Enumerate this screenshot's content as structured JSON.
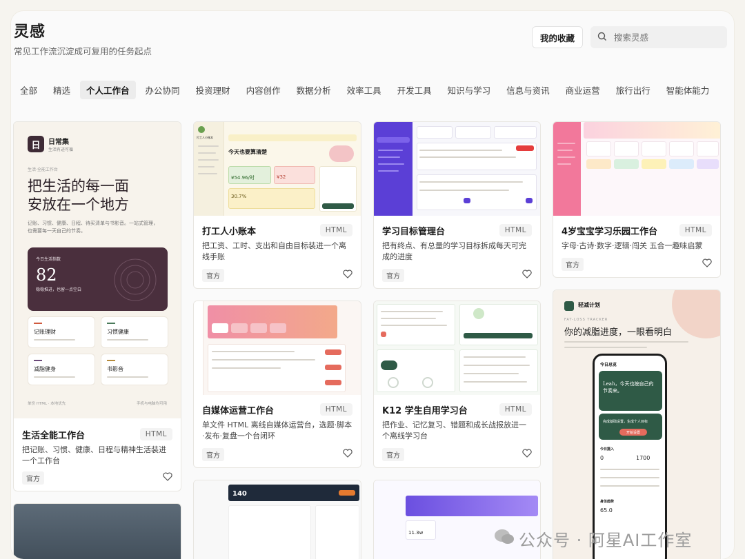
{
  "header": {
    "title": "灵感",
    "subtitle": "常见工作流沉淀成可复用的任务起点",
    "favorites_label": "我的收藏",
    "search_placeholder": "搜索灵感"
  },
  "tabs": [
    "全部",
    "精选",
    "个人工作台",
    "办公协同",
    "投资理财",
    "内容创作",
    "数据分析",
    "效率工具",
    "开发工具",
    "知识与学习",
    "信息与资讯",
    "商业运营",
    "旅行出行",
    "智能体能力"
  ],
  "active_tab": "个人工作台",
  "cards": [
    {
      "title": "生活全能工作台",
      "badge": "HTML",
      "desc": "把记账、习惯、健康、日程与精神生活装进一个工作台",
      "tag": "官方"
    },
    {
      "title": "打工人小账本",
      "badge": "HTML",
      "desc": "把工资、工时、支出和自由目标装进一个离线手账",
      "tag": "官方"
    },
    {
      "title": "学习目标管理台",
      "badge": "HTML",
      "desc": "把有终点、有总量的学习目标拆成每天可完成的进度",
      "tag": "官方"
    },
    {
      "title": "4岁宝宝学习乐园工作台",
      "badge": "HTML",
      "desc": "字母·古诗·数字·逻辑·闯关 五合一趣味启蒙",
      "tag": "官方"
    },
    {
      "title": "自媒体运营工作台",
      "badge": "HTML",
      "desc": "单文件 HTML 离线自媒体运营台，选题·脚本·发布·复盘一个台闭环",
      "tag": "官方"
    },
    {
      "title": "K12 学生自用学习台",
      "badge": "HTML",
      "desc": "把作业、记忆复习、错题和成长战报放进一个离线学习台",
      "tag": "官方"
    }
  ],
  "preview_life": {
    "brand": "日常集",
    "brand_sub": "生活有迹可循",
    "kicker": "生活·全能工作台",
    "headline_1": "把生活的每一面",
    "headline_2": "安放在一个地方",
    "body": "记账、习惯、健康、日程、待买清单与书影音。一站式管理，也需要每一天自己的节奏。",
    "stat_label": "今日生活指数",
    "stat_value": "82",
    "stat_note": "稳稳推进，也留一点空白",
    "tiles": [
      "记账理财",
      "习惯健康",
      "减脂健身",
      "书影音"
    ],
    "footer_left": "单份 HTML · 本地优先",
    "footer_right": "手机与电脑均可用"
  },
  "preview_ledger": {
    "brand": "打工人小账本",
    "title": "今天也要算清楚",
    "amount_1": "¥54.96/时",
    "amount_2": "¥32",
    "percent": "30.7%"
  },
  "preview_fitness": {
    "brand": "轻减计划",
    "kicker": "FAT-LOSS TRACKER",
    "headline_1": "你的减脂进度，一眼看明白",
    "phone_title": "今日总览",
    "greeting": "Leah，今天也按自己的节奏来。",
    "card_title": "完成基础设置，生成个人目标",
    "button": "开始设置",
    "section": "今日摄入",
    "value_1": "0",
    "value_2": "1700",
    "section_2": "身体趋势",
    "value_3": "65.0"
  },
  "preview_k12": {
    "stat": "140",
    "stat_2": "11.3w"
  },
  "watermark": "公众号 · 阿星AI工作室",
  "colors": {
    "accent_dark": "#4a2f3d",
    "accent_green": "#2f5a46",
    "accent_purple": "#5b3fd6",
    "accent_coral": "#e56b5d",
    "accent_pink": "#f2789b"
  }
}
